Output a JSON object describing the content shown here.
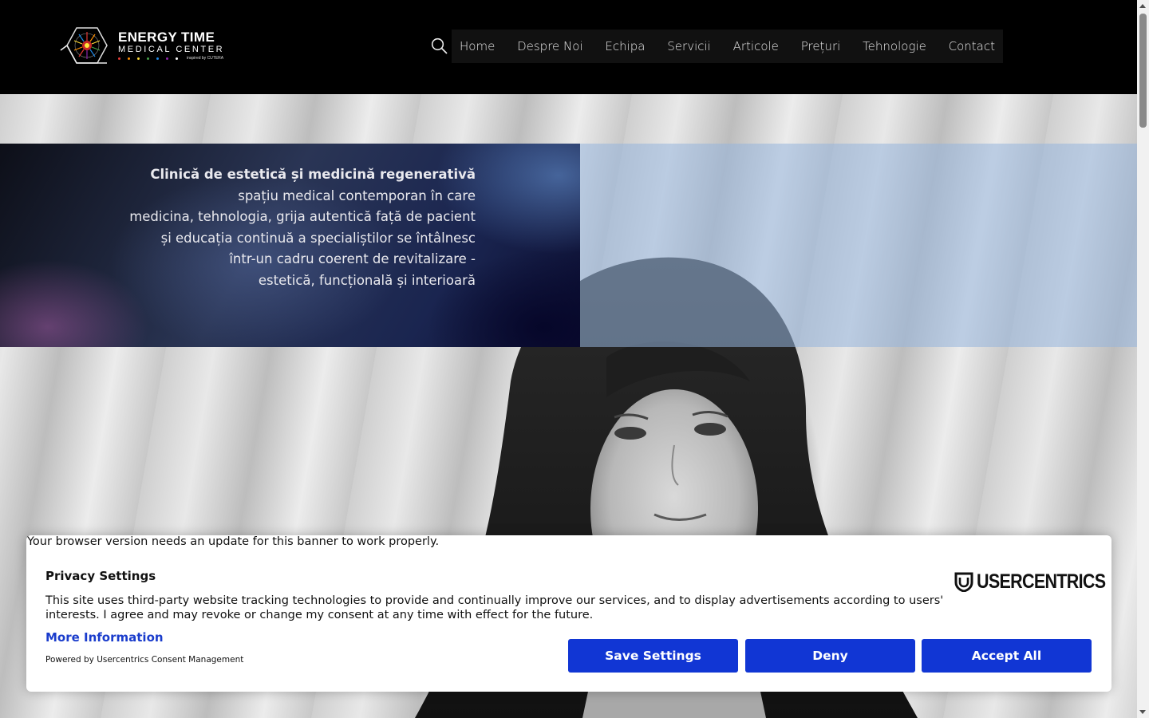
{
  "header": {
    "logo": {
      "title": "ENERGY TIME",
      "subtitle": "MEDICAL CENTER",
      "tagline": "inspired by CUTERA",
      "dot_colors": [
        "#e53935",
        "#fb8c00",
        "#fdd835",
        "#43a047",
        "#1e88e5",
        "#8e24aa",
        "#ffffff"
      ]
    },
    "search_icon": "search-icon",
    "nav": [
      {
        "label": "Home"
      },
      {
        "label": "Despre Noi"
      },
      {
        "label": "Echipa"
      },
      {
        "label": "Servicii"
      },
      {
        "label": "Articole"
      },
      {
        "label": "Prețuri"
      },
      {
        "label": "Tehnologie"
      },
      {
        "label": "Contact"
      }
    ]
  },
  "hero": {
    "lead": "Clinică de estetică și medicină regenerativă",
    "lines": [
      "spațiu medical contemporan în care",
      "medicina, tehnologia, grija autentică față de pacient",
      "și educația continuă a specialiștilor se întâlnesc",
      "într-un cadru coerent de revitalizare -",
      "estetică, funcțională și interioară"
    ]
  },
  "consent": {
    "browser_notice": "Your browser version needs an update for this banner to work properly.",
    "title": "Privacy Settings",
    "text": "This site uses third-party website tracking technologies to provide and continually improve our services, and to display advertisements according to users' interests. I agree and may revoke or change my consent at any time with effect for the future.",
    "more_info": "More Information",
    "powered_by": "Powered by Usercentrics Consent Management",
    "brand": "USERCENTRICS",
    "buttons": {
      "save": "Save Settings",
      "deny": "Deny",
      "accept": "Accept All"
    },
    "accent_color": "#1136d4"
  }
}
